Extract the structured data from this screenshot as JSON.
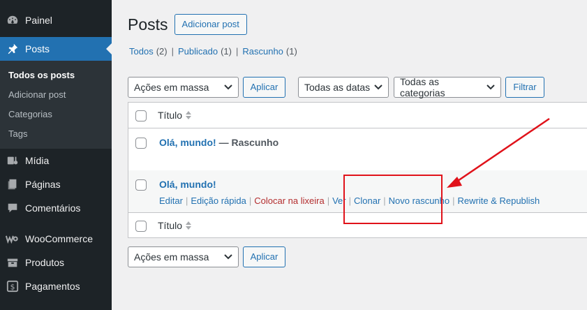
{
  "sidebar": {
    "items": [
      {
        "label": "Painel",
        "icon": "dashboard-icon"
      },
      {
        "label": "Posts",
        "icon": "pin-icon",
        "current": true
      },
      {
        "label": "Mídia",
        "icon": "media-icon"
      },
      {
        "label": "Páginas",
        "icon": "pages-icon"
      },
      {
        "label": "Comentários",
        "icon": "comments-icon"
      },
      {
        "label": "WooCommerce",
        "icon": "woocommerce-icon"
      },
      {
        "label": "Produtos",
        "icon": "products-icon"
      },
      {
        "label": "Pagamentos",
        "icon": "payments-icon"
      }
    ],
    "submenu": [
      "Todos os posts",
      "Adicionar post",
      "Categorias",
      "Tags"
    ]
  },
  "header": {
    "title": "Posts",
    "add_button": "Adicionar post"
  },
  "views": {
    "all": {
      "label": "Todos",
      "count": "(2)"
    },
    "published": {
      "label": "Publicado",
      "count": "(1)"
    },
    "draft": {
      "label": "Rascunho",
      "count": "(1)"
    },
    "separator": "|"
  },
  "filters": {
    "bulk_actions": "Ações em massa",
    "apply": "Aplicar",
    "dates": "Todas as datas",
    "categories": "Todas as categorias",
    "filter": "Filtrar"
  },
  "table": {
    "column_title": "Título",
    "rows": [
      {
        "title": "Olá, mundo!",
        "state": "— Rascunho"
      },
      {
        "title": "Olá, mundo!",
        "state": ""
      }
    ],
    "row_actions": [
      "Editar",
      "Edição rápida",
      "Colocar na lixeira",
      "Ver",
      "Clonar",
      "Novo rascunho",
      "Rewrite & Republish"
    ]
  },
  "colors": {
    "accent": "#2271b1",
    "sidebar_bg": "#1d2327",
    "trash": "#b32d2e",
    "annotation": "#e0121a"
  }
}
